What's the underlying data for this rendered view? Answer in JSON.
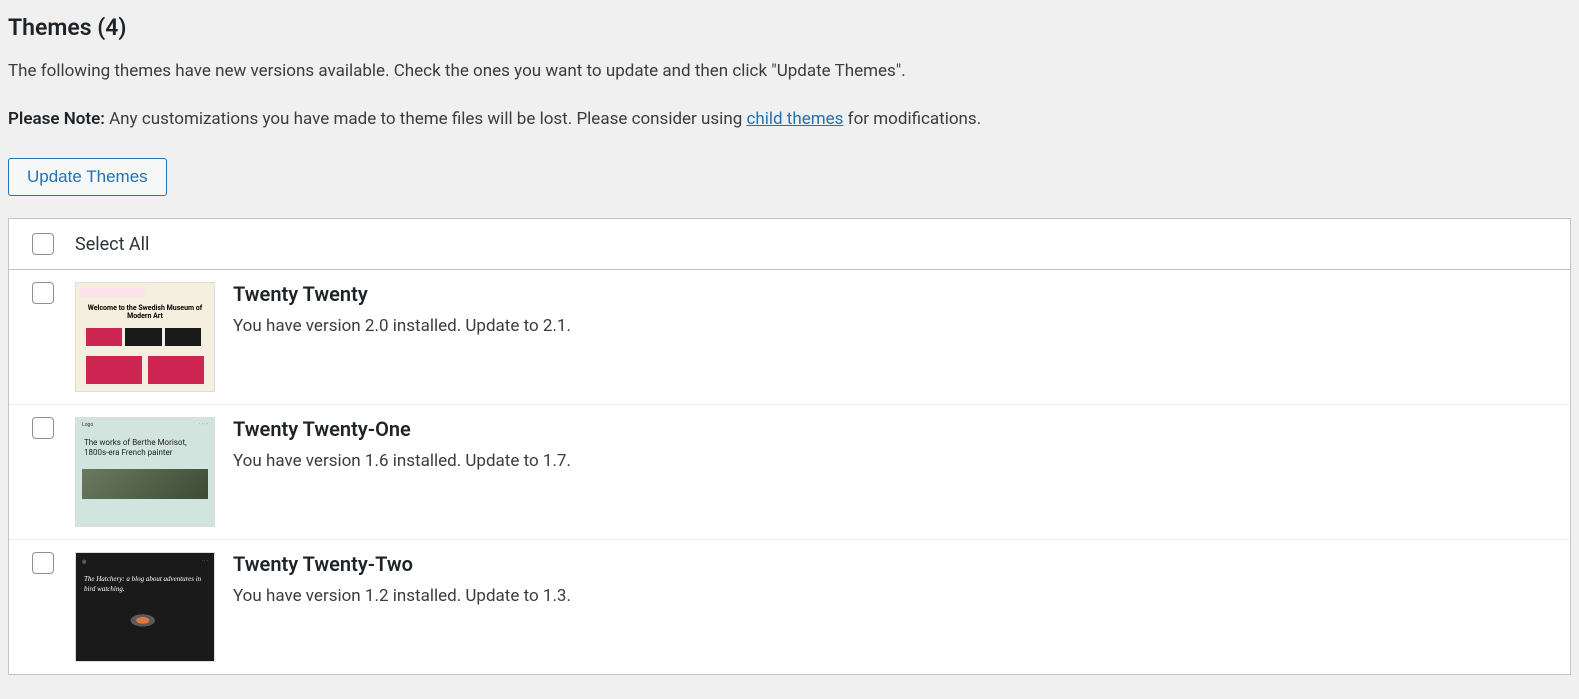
{
  "title": "Themes (4)",
  "intro": "The following themes have new versions available. Check the ones you want to update and then click \"Update Themes\".",
  "note_prefix": "Please Note:",
  "note_body_before_link": " Any customizations you have made to theme files will be lost. Please consider using ",
  "note_link_text": "child themes",
  "note_body_after_link": " for modifications.",
  "update_button": "Update Themes",
  "select_all": "Select All",
  "themes": [
    {
      "name": "Twenty Twenty",
      "desc": "You have version 2.0 installed. Update to 2.1.",
      "thumb_title": "Welcome to the Swedish Museum of Modern Art"
    },
    {
      "name": "Twenty Twenty-One",
      "desc": "You have version 1.6 installed. Update to 1.7.",
      "thumb_title": "The works of Berthe Morisot, 1800s-era French painter"
    },
    {
      "name": "Twenty Twenty-Two",
      "desc": "You have version 1.2 installed. Update to 1.3.",
      "thumb_title": "The Hatchery: a blog about adventures in bird watching."
    }
  ]
}
